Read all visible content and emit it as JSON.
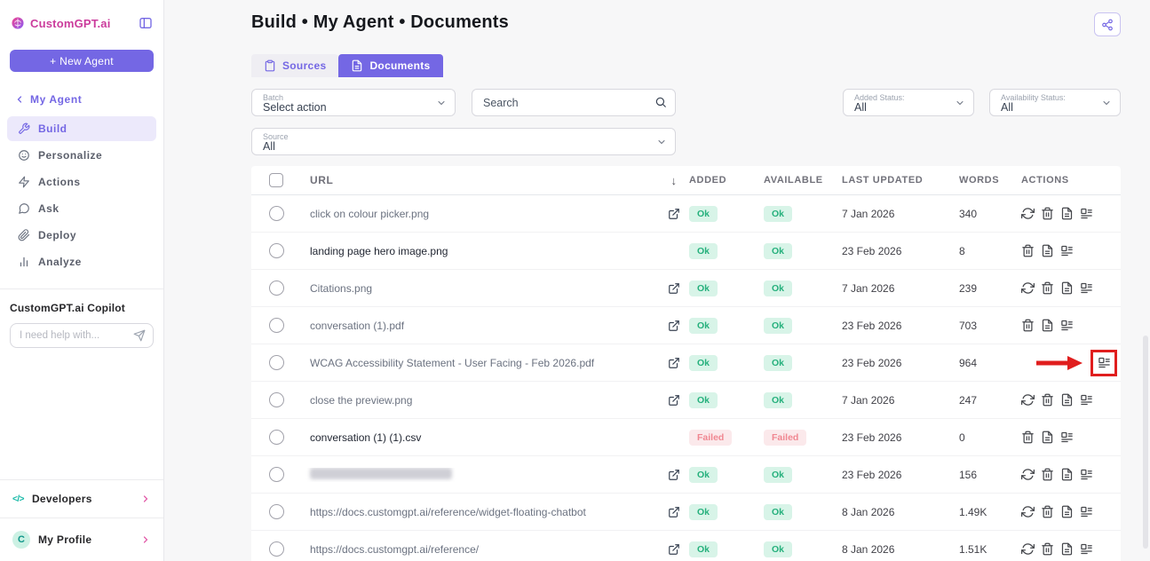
{
  "colors": {
    "accent": "#7467e4",
    "brand_pink": "#cb3b9c",
    "ok_bg": "#d8f4e8",
    "ok_text": "#25b07c",
    "failed_bg": "#fbe9eb",
    "failed_text": "#f08791",
    "annotation_red": "#e01e1e"
  },
  "sidebar": {
    "brand": "CustomGPT.ai",
    "new_agent": "+ New Agent",
    "agent": "My Agent",
    "nav": [
      {
        "label": "Build",
        "icon": "hammer-icon",
        "active": true
      },
      {
        "label": "Personalize",
        "icon": "face-icon",
        "active": false
      },
      {
        "label": "Actions",
        "icon": "bolt-icon",
        "active": false
      },
      {
        "label": "Ask",
        "icon": "chat-bubble-icon",
        "active": false
      },
      {
        "label": "Deploy",
        "icon": "paperclip-icon",
        "active": false
      },
      {
        "label": "Analyze",
        "icon": "bar-chart-icon",
        "active": false
      }
    ],
    "copilot_title": "CustomGPT.ai Copilot",
    "copilot_placeholder": "I need help with...",
    "developers": "Developers",
    "profile": "My Profile",
    "profile_initial": "C"
  },
  "header": {
    "title": "Build • My Agent • Documents"
  },
  "tabs": {
    "sources": "Sources",
    "documents": "Documents",
    "active": "Documents"
  },
  "filters": {
    "batch_label": "Batch",
    "batch_value": "Select action",
    "search_placeholder": "Search",
    "added_label": "Added Status:",
    "added_value": "All",
    "availability_label": "Availability Status:",
    "availability_value": "All",
    "source_label": "Source",
    "source_value": "All"
  },
  "table": {
    "sort_glyph": "↓",
    "headers": {
      "url": "URL",
      "added": "ADDED",
      "available": "AVAILABLE",
      "updated": "LAST UPDATED",
      "words": "WORDS",
      "actions": "ACTIONS"
    },
    "rows": [
      {
        "url": "click on colour picker.png",
        "added": "Ok",
        "available": "Ok",
        "updated": "7 Jan 2026",
        "words": "340"
      },
      {
        "url": "landing page hero image.png",
        "added": "Ok",
        "available": "Ok",
        "updated": "23 Feb 2026",
        "words": "8"
      },
      {
        "url": "Citations.png",
        "added": "Ok",
        "available": "Ok",
        "updated": "7 Jan 2026",
        "words": "239"
      },
      {
        "url": "conversation (1).pdf",
        "added": "Ok",
        "available": "Ok",
        "updated": "23 Feb 2026",
        "words": "703"
      },
      {
        "url": "WCAG Accessibility Statement - User Facing - Feb 2026.pdf",
        "added": "Ok",
        "available": "Ok",
        "updated": "23 Feb 2026",
        "words": "964"
      },
      {
        "url": "close the preview.png",
        "added": "Ok",
        "available": "Ok",
        "updated": "7 Jan 2026",
        "words": "247"
      },
      {
        "url": "conversation (1) (1).csv",
        "added": "Failed",
        "available": "Failed",
        "updated": "23 Feb 2026",
        "words": "0"
      },
      {
        "url": "",
        "redacted": true,
        "added": "Ok",
        "available": "Ok",
        "updated": "23 Feb 2026",
        "words": "156"
      },
      {
        "url": "https://docs.customgpt.ai/reference/widget-floating-chatbot",
        "added": "Ok",
        "available": "Ok",
        "updated": "8 Jan 2026",
        "words": "1.49K"
      },
      {
        "url": "https://docs.customgpt.ai/reference/",
        "added": "Ok",
        "available": "Ok",
        "updated": "8 Jan 2026",
        "words": "1.51K"
      }
    ]
  },
  "annotation": {
    "target_row": 4,
    "shape": "red arrow pointing to highlighted citation icon"
  }
}
